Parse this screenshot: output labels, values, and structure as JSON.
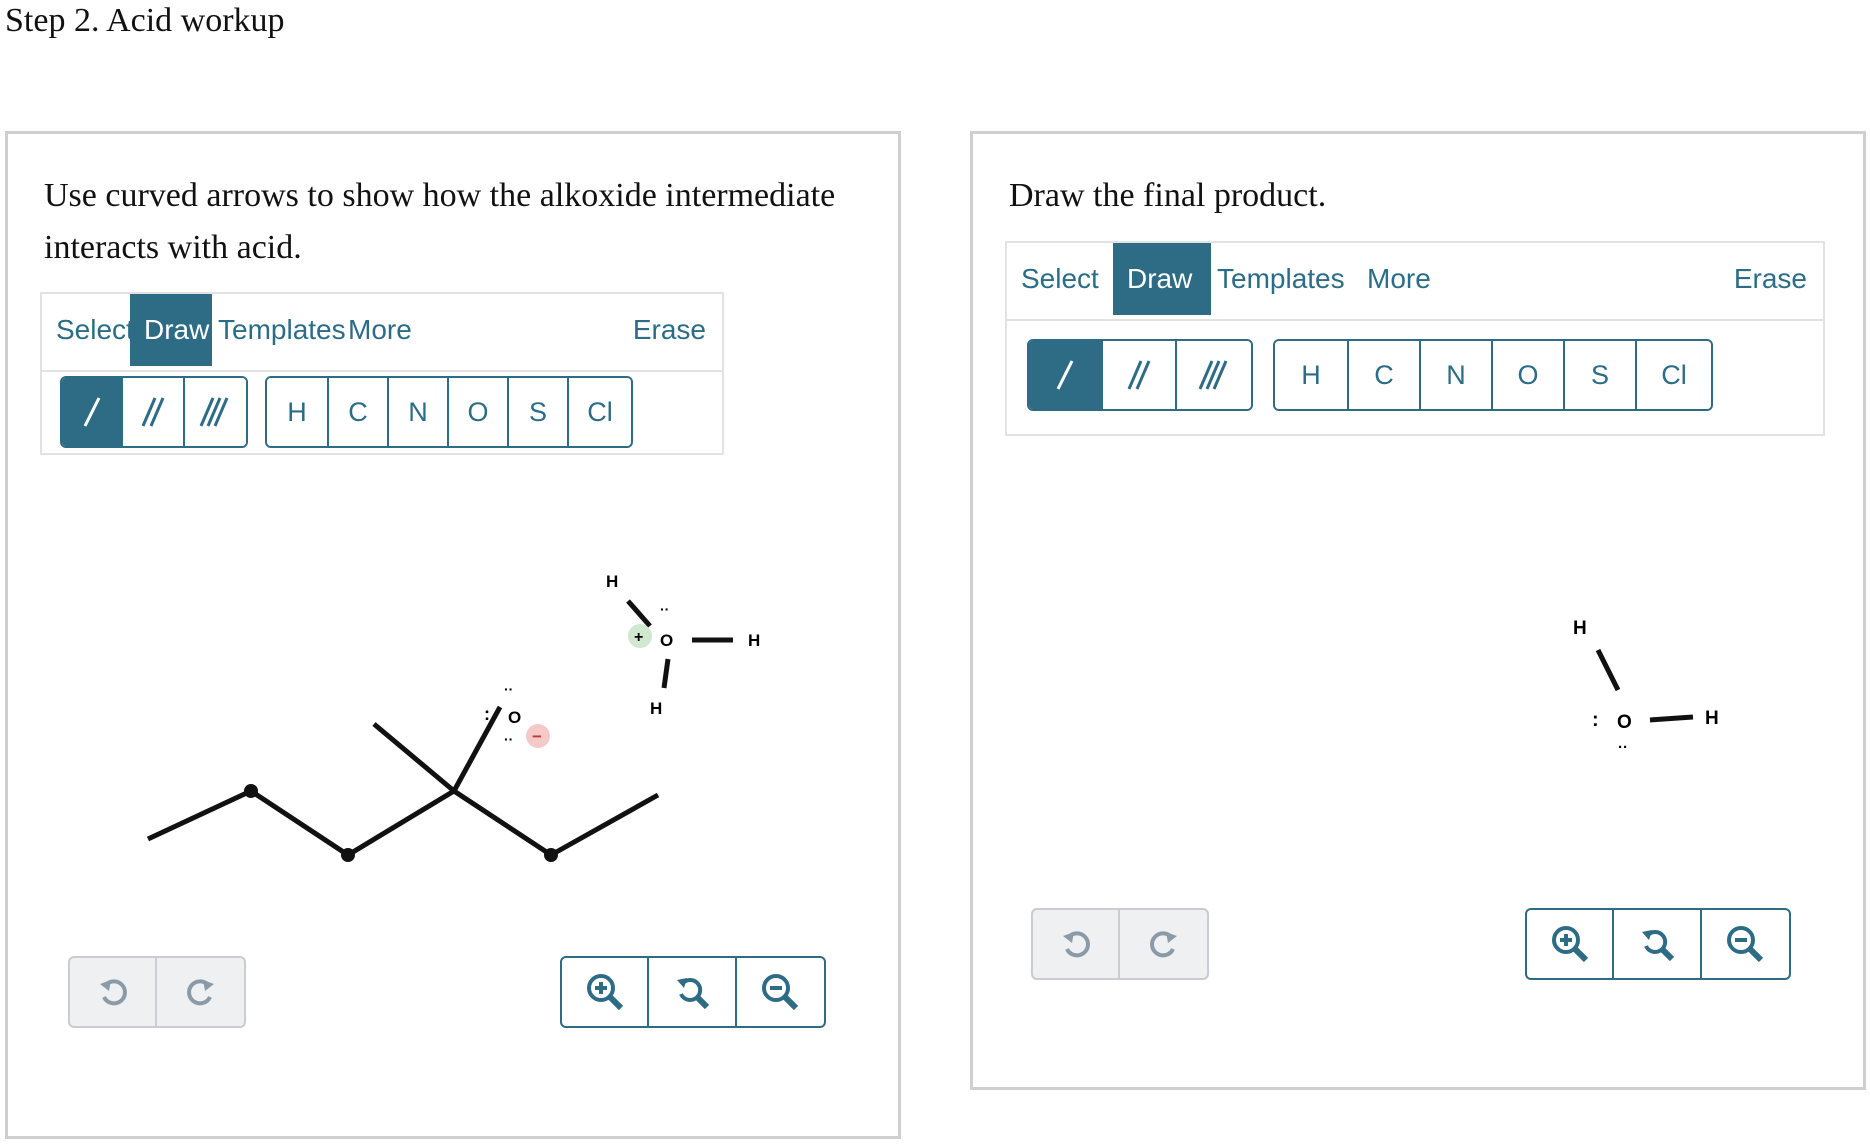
{
  "step_title": "Step 2. Acid workup",
  "left_panel": {
    "prompt": "Use curved arrows to show how the alkoxide intermediate interacts with acid.",
    "tabs": [
      "Select",
      "Draw",
      "Templates",
      "More"
    ],
    "active_tab": "Draw",
    "erase_label": "Erase",
    "bond_tools": [
      "single-bond-icon",
      "double-bond-icon",
      "triple-bond-icon"
    ],
    "atoms": [
      "H",
      "C",
      "N",
      "O",
      "S",
      "Cl"
    ],
    "molecule": {
      "hydronium_atoms": [
        "H",
        "O",
        "H",
        "H"
      ],
      "hydronium_charge": "+",
      "alkoxide_atom": "O",
      "alkoxide_charge": "−"
    }
  },
  "right_panel": {
    "prompt": "Draw the final product.",
    "tabs": [
      "Select",
      "Draw",
      "Templates",
      "More"
    ],
    "active_tab": "Draw",
    "erase_label": "Erase",
    "bond_tools": [
      "single-bond-icon",
      "double-bond-icon",
      "triple-bond-icon"
    ],
    "atoms": [
      "H",
      "C",
      "N",
      "O",
      "S",
      "Cl"
    ],
    "molecule": {
      "water_atoms": [
        "H",
        "O",
        "H"
      ]
    }
  },
  "controls": {
    "undo_icons": [
      "undo-icon",
      "redo-icon"
    ],
    "zoom_icons": [
      "zoom-in-icon",
      "zoom-reset-icon",
      "zoom-out-icon"
    ]
  },
  "colors": {
    "accent": "#2e6c85",
    "panel_border": "#cfcfcf",
    "plus_charge": "#cfe8cf",
    "minus_charge": "#f6c9c9"
  }
}
